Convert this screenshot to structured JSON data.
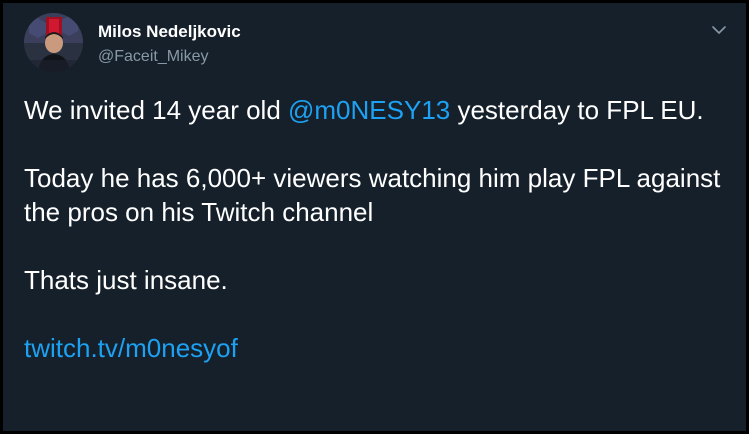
{
  "tweet": {
    "author": {
      "name": "Milos Nedeljkovic",
      "handle": "@Faceit_Mikey",
      "avatar_icon": "avatar-photo-icon"
    },
    "menu_icon": "chevron-down-icon",
    "paragraphs": [
      {
        "before": "We invited 14 year old ",
        "mention": "@m0NESY13",
        "after": " yesterday to FPL EU."
      },
      {
        "text": "Today he has 6,000+ viewers watching him play FPL against the pros on his Twitch channel"
      },
      {
        "text": "Thats just insane."
      },
      {
        "link": "twitch.tv/m0nesyof"
      }
    ]
  },
  "colors": {
    "background": "#15202b",
    "frame": "#000000",
    "text": "#ffffff",
    "secondary_text": "#8899a6",
    "link": "#1da1f2"
  }
}
